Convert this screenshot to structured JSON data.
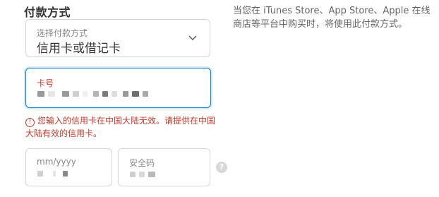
{
  "payment": {
    "title": "付款方式",
    "method_select": {
      "label": "选择付款方式",
      "value": "信用卡或借记卡"
    },
    "card_number": {
      "label": "卡号"
    },
    "error_message": "您输入的信用卡在中国大陆无效。请提供在中国大陆有效的信用卡。",
    "expiry": {
      "placeholder": "mm/yyyy"
    },
    "security_code": {
      "label": "安全码"
    },
    "help_icon": "?"
  },
  "info": {
    "text": "当您在 iTunes Store、App Store、Apple 在线商店等平台中购买时，将使用此付款方式。"
  },
  "icons": {
    "chevron": "chevron-down-icon",
    "error": "alert-circle-icon",
    "help": "question-circle-icon"
  },
  "colors": {
    "focus_border": "#0a84c7",
    "error": "#c0392b"
  }
}
